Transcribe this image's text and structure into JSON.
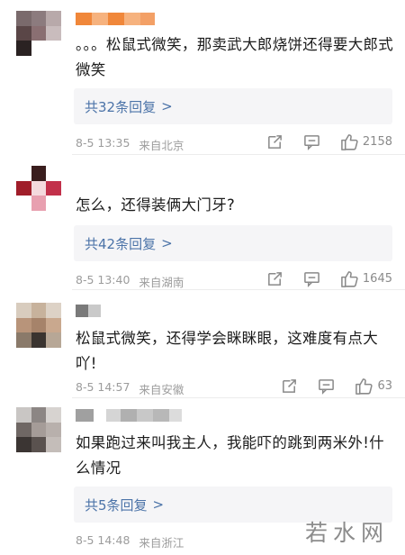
{
  "comments": [
    {
      "text": "。。。松鼠式微笑，那卖武大郎烧饼还得要大郎式微笑",
      "replies_label": "共32条回复",
      "reply_arrow": ">",
      "date": "8-5 13:35",
      "location": "来自北京",
      "likes": "2158"
    },
    {
      "text": "怎么，还得装俩大门牙?",
      "replies_label": "共42条回复",
      "reply_arrow": ">",
      "date": "8-5 13:40",
      "location": "来自湖南",
      "likes": "1645"
    },
    {
      "text": "松鼠式微笑，还得学会眯眯眼，这难度有点大吖!",
      "date": "8-5 14:57",
      "location": "来自安徽",
      "likes": "63"
    },
    {
      "text": "如果跑过来叫我主人，我能吓的跳到两米外!什么情况",
      "replies_label": "共5条回复",
      "reply_arrow": ">",
      "date": "8-5 14:48",
      "location": "来自浙江",
      "likes": ""
    }
  ],
  "watermark": "若水网",
  "colors": {
    "link_blue": "#4b73a8",
    "meta_gray": "#9c9c9c",
    "reply_bg": "#f5f5f7"
  },
  "icons": {
    "share": "share-icon",
    "comment": "comment-icon",
    "like": "thumbs-up-icon"
  }
}
